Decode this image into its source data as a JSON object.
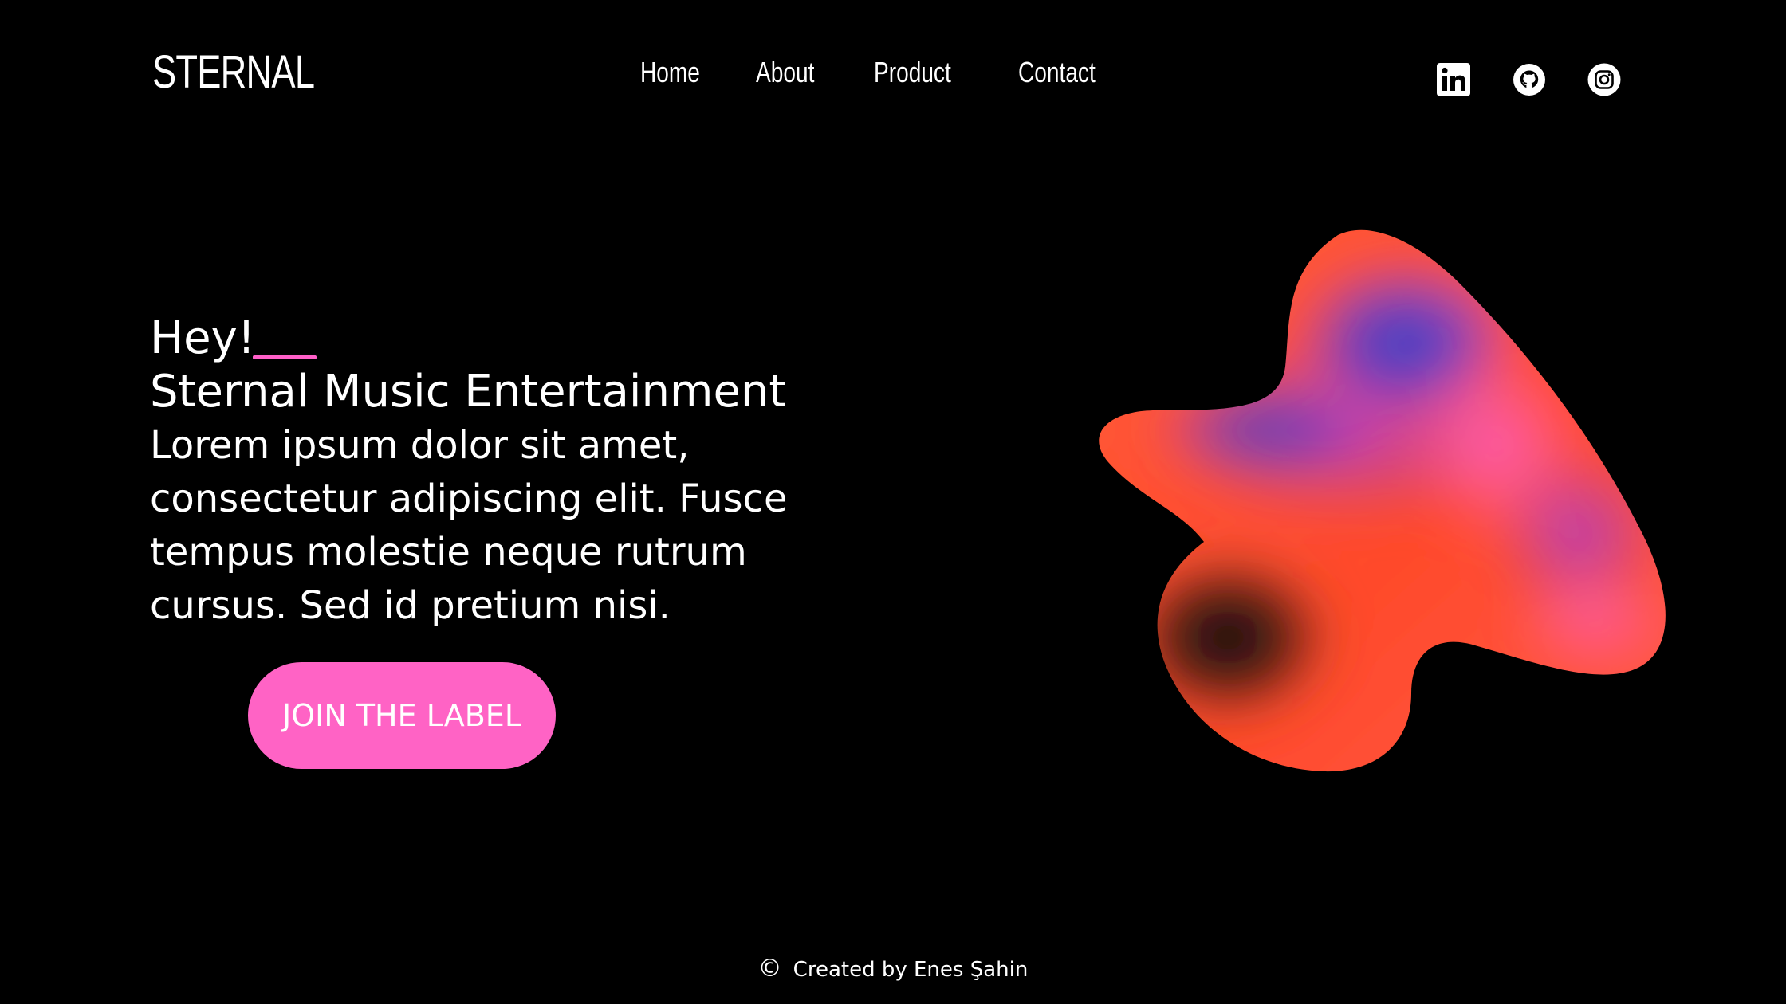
{
  "brand": {
    "logo_text": "STERNAL"
  },
  "nav": {
    "items": [
      {
        "label": "Home"
      },
      {
        "label": "About"
      },
      {
        "label": "Product"
      },
      {
        "label": "Contact"
      }
    ]
  },
  "social": {
    "icons": [
      "linkedin-icon",
      "github-icon",
      "instagram-icon"
    ]
  },
  "hero": {
    "greeting": "Hey!",
    "headline": "Sternal Music Entertainment",
    "body": "Lorem ipsum dolor sit amet, consectetur adipiscing elit. Fusce tempus molestie neque rutrum cursus. Sed id pretium nisi.",
    "cta_label": "JOIN THE LABEL"
  },
  "footer": {
    "copyright_symbol": "©",
    "credit": "Created by Enes Şahin"
  },
  "colors": {
    "background": "#000000",
    "text": "#ffffff",
    "accent_pink": "#ff63c5",
    "blob_red": "#ff4a2a",
    "blob_blue": "#2b48c8"
  }
}
